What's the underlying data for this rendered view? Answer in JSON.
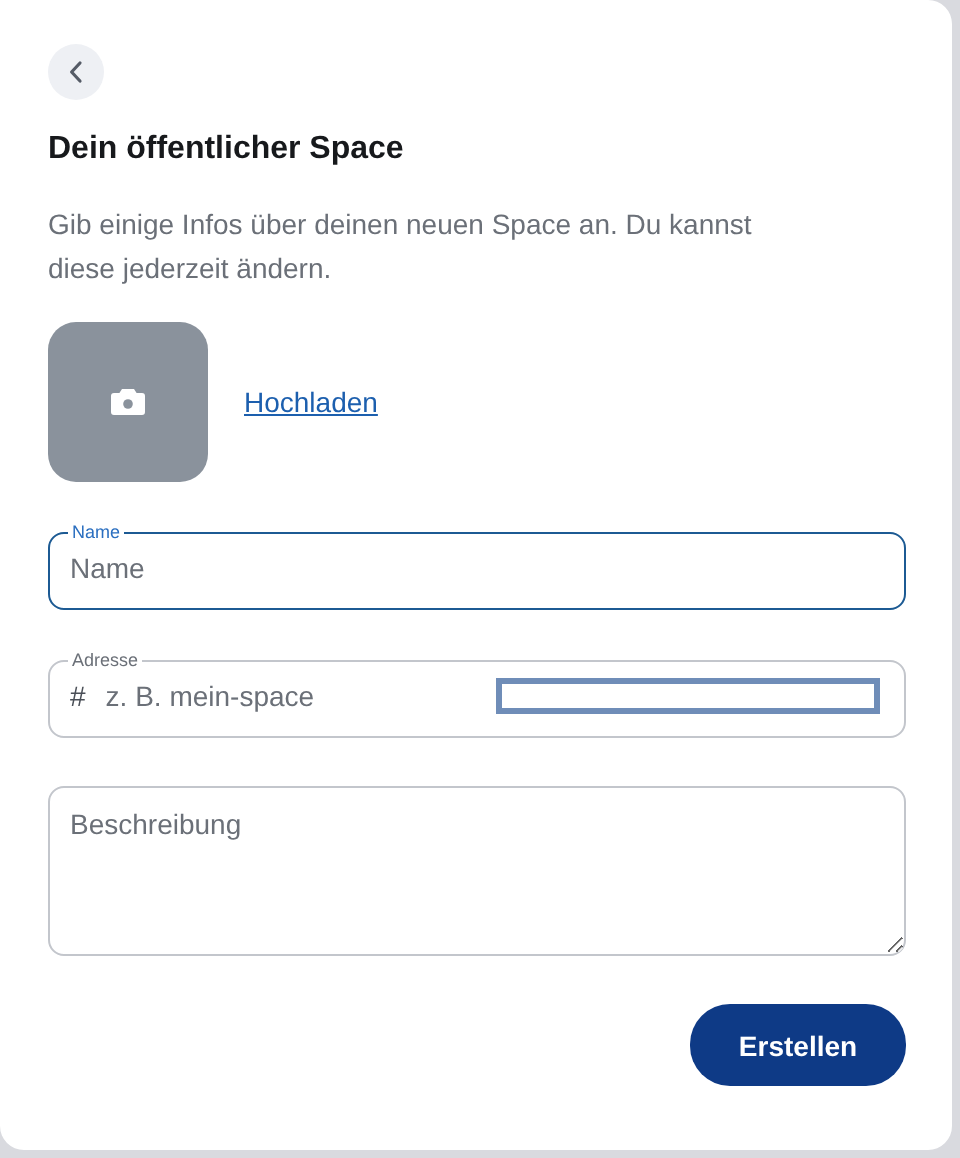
{
  "title": "Dein öffentlicher Space",
  "intro": "Gib einige Infos über deinen neuen Space an. Du kannst diese jederzeit ändern.",
  "avatar_upload": {
    "link": "Hochladen"
  },
  "fields": [
    {
      "kind": "text",
      "label": "Name",
      "placeholder": "Name",
      "focused": true
    },
    {
      "kind": "address",
      "label": "Adresse",
      "prefix": "#",
      "placeholder": "z. B. mein-space",
      "focused": false
    },
    {
      "kind": "textarea",
      "placeholder": "Beschreibung",
      "focused": false
    }
  ],
  "submit_button": {
    "label": "Erstellen"
  }
}
